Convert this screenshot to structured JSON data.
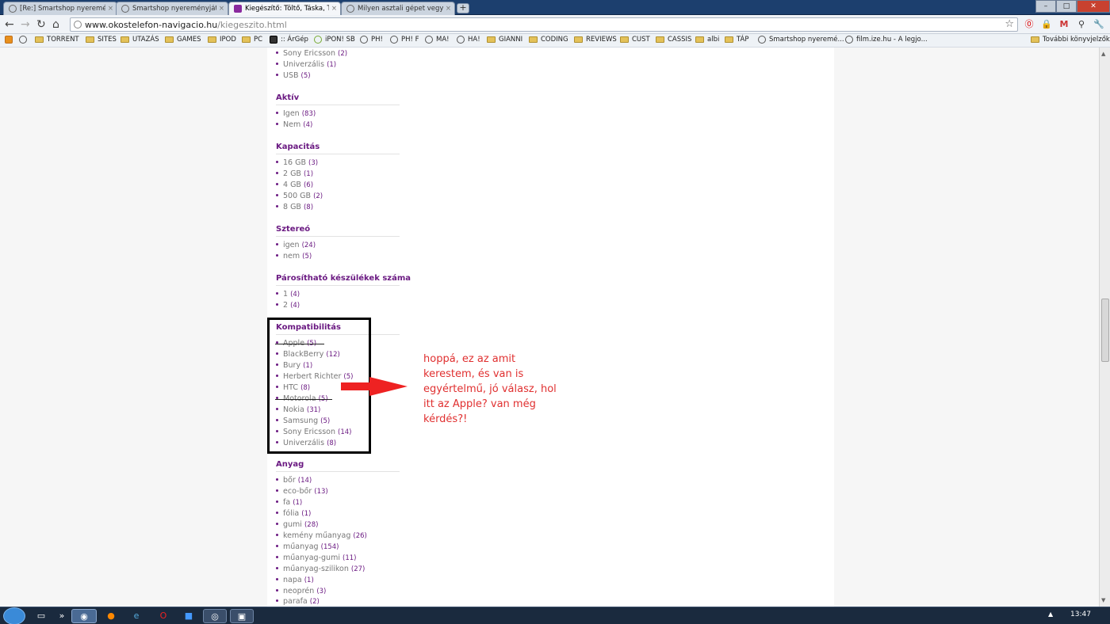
{
  "tabs": [
    {
      "title": "[Re:] Smartshop nyeremén",
      "active": false
    },
    {
      "title": "Smartshop nyereményjáték",
      "active": false
    },
    {
      "title": "Kiegészítő: Töltő, Táska, Tok",
      "active": true
    },
    {
      "title": "Milyen asztali gépet vegyek",
      "active": false
    }
  ],
  "new_tab_label": "+",
  "address": {
    "domain": "www.okostelefon-navigacio.hu",
    "path": "/kiegeszito.html"
  },
  "bookmarks": [
    "TORRENT",
    "SITES",
    "UTAZÁS",
    "GAMES",
    "IPOD",
    "PC",
    ":: ÁrGép",
    "iPON! SB",
    "PH!",
    "PH! F",
    "MA!",
    "HA!",
    "GIANNI",
    "CODING",
    "REVIEWS",
    "CUST",
    "CASSIS",
    "albi",
    "TÁP",
    "Smartshop nyeremé...",
    "film.ize.hu - A legjo..."
  ],
  "other_bookmarks": "További könyvjelzők",
  "filters": {
    "top_items": [
      {
        "label": "Sony Ericsson",
        "count": "(2)"
      },
      {
        "label": "Univerzális",
        "count": "(1)"
      },
      {
        "label": "USB",
        "count": "(5)"
      }
    ],
    "groups": [
      {
        "title": "Aktív",
        "items": [
          {
            "label": "Igen",
            "count": "(83)"
          },
          {
            "label": "Nem",
            "count": "(4)"
          }
        ]
      },
      {
        "title": "Kapacitás",
        "items": [
          {
            "label": "16 GB",
            "count": "(3)"
          },
          {
            "label": "2 GB",
            "count": "(1)"
          },
          {
            "label": "4 GB",
            "count": "(6)"
          },
          {
            "label": "500 GB",
            "count": "(2)"
          },
          {
            "label": "8 GB",
            "count": "(8)"
          }
        ]
      },
      {
        "title": "Sztereó",
        "items": [
          {
            "label": "igen",
            "count": "(24)"
          },
          {
            "label": "nem",
            "count": "(5)"
          }
        ]
      },
      {
        "title": "Párosítható készülékek száma",
        "items": [
          {
            "label": "1",
            "count": "(4)"
          },
          {
            "label": "2",
            "count": "(4)"
          }
        ]
      },
      {
        "title": "Kompatibilitás",
        "items": [
          {
            "label": "Apple",
            "count": "(5)"
          },
          {
            "label": "BlackBerry",
            "count": "(12)"
          },
          {
            "label": "Bury",
            "count": "(1)"
          },
          {
            "label": "Herbert Richter",
            "count": "(5)"
          },
          {
            "label": "HTC",
            "count": "(8)"
          },
          {
            "label": "Motorola",
            "count": "(5)"
          },
          {
            "label": "Nokia",
            "count": "(31)"
          },
          {
            "label": "Samsung",
            "count": "(5)"
          },
          {
            "label": "Sony Ericsson",
            "count": "(14)"
          },
          {
            "label": "Univerzális",
            "count": "(8)"
          }
        ]
      },
      {
        "title": "Anyag",
        "items": [
          {
            "label": "bőr",
            "count": "(14)"
          },
          {
            "label": "eco-bőr",
            "count": "(13)"
          },
          {
            "label": "fa",
            "count": "(1)"
          },
          {
            "label": "fólia",
            "count": "(1)"
          },
          {
            "label": "gumi",
            "count": "(28)"
          },
          {
            "label": "kemény műanyag",
            "count": "(26)"
          },
          {
            "label": "műanyag",
            "count": "(154)"
          },
          {
            "label": "műanyag-gumi",
            "count": "(11)"
          },
          {
            "label": "műanyag-szilikon",
            "count": "(27)"
          },
          {
            "label": "napa",
            "count": "(1)"
          },
          {
            "label": "neoprén",
            "count": "(3)"
          },
          {
            "label": "parafa",
            "count": "(2)"
          }
        ]
      }
    ]
  },
  "annotation": {
    "lines": [
      "hoppá, ez az amit",
      "kerestem, és van is",
      "egyértelmű, jó válasz, hol",
      "itt az Apple? van még",
      "kérdés?!"
    ],
    "color": "#e03030"
  },
  "colors": {
    "accent": "#6b1a82",
    "count": "#6b1a82"
  },
  "clock": "13:47"
}
